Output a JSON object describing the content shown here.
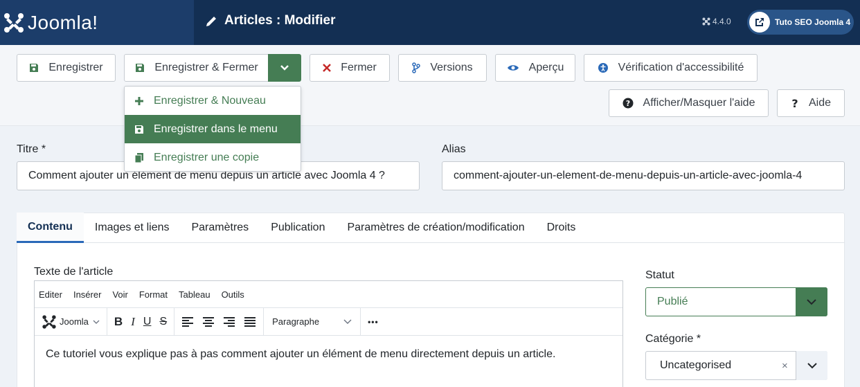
{
  "header": {
    "logo_text": "Joomla!",
    "page_title": "Articles : Modifier",
    "version": "4.4.0",
    "site_button": "Tuto SEO Joomla 4"
  },
  "toolbar": {
    "save": "Enregistrer",
    "save_close": "Enregistrer & Fermer",
    "close": "Fermer",
    "versions": "Versions",
    "preview": "Aperçu",
    "accessibility": "Vérification d'accessibilité",
    "toggle_help": "Afficher/Masquer l'aide",
    "help": "Aide"
  },
  "dropdown": {
    "items": [
      {
        "label": "Enregistrer & Nouveau"
      },
      {
        "label": "Enregistrer dans le menu"
      },
      {
        "label": "Enregistrer une copie"
      }
    ]
  },
  "form": {
    "title_label": "Titre *",
    "title_value": "Comment ajouter un élément de menu depuis un article avec Joomla 4 ?",
    "alias_label": "Alias",
    "alias_value": "comment-ajouter-un-element-de-menu-depuis-un-article-avec-joomla-4"
  },
  "tabs": [
    {
      "label": "Contenu"
    },
    {
      "label": "Images et liens"
    },
    {
      "label": "Paramètres"
    },
    {
      "label": "Publication"
    },
    {
      "label": "Paramètres de création/modification"
    },
    {
      "label": "Droits"
    }
  ],
  "editor": {
    "label": "Texte de l'article",
    "menus": [
      "Editer",
      "Insérer",
      "Voir",
      "Format",
      "Tableau",
      "Outils"
    ],
    "joomla_btn": "Joomla",
    "bold": "B",
    "italic": "I",
    "underline": "U",
    "strike": "S",
    "block_format": "Paragraphe",
    "more": "•••",
    "content": "Ce tutoriel vous explique pas à pas comment ajouter un élément de menu directement depuis un article."
  },
  "sidebar": {
    "status_label": "Statut",
    "status_value": "Publié",
    "category_label": "Catégorie *",
    "category_value": "Uncategorised",
    "clear": "×"
  },
  "colors": {
    "header_bg": "#132f53",
    "accent_green": "#457d54",
    "link_blue": "#2a69b8"
  }
}
